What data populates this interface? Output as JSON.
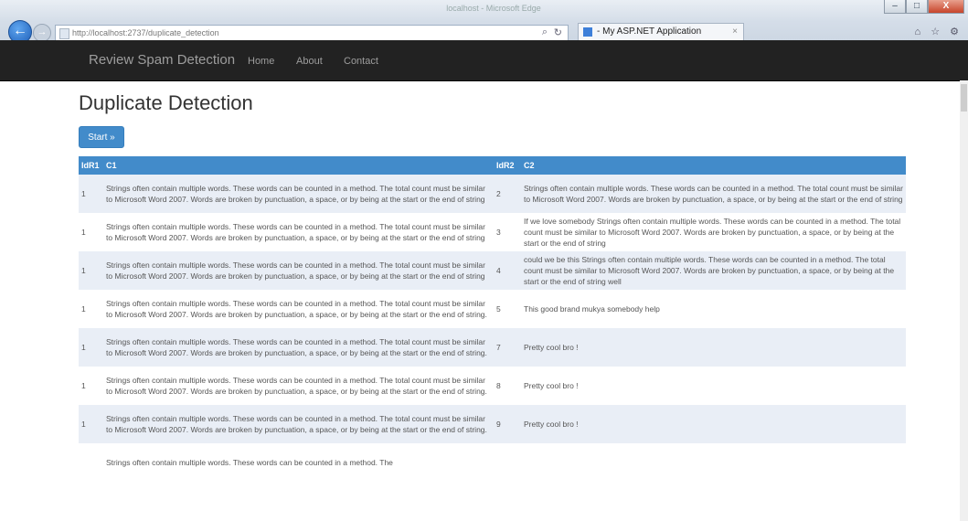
{
  "browser": {
    "window_title": "localhost - Microsoft Edge",
    "url": "http://localhost:2737/duplicate_detection",
    "tab_title": "- My ASP.NET Application",
    "tab_close": "×",
    "back": "←",
    "forward": "→",
    "win_min": "–",
    "win_max": "□",
    "win_close": "X",
    "right_icons": "⌂ ☆ ⚙"
  },
  "navbar": {
    "brand": "Review Spam Detection",
    "links": [
      "Home",
      "About",
      "Contact"
    ]
  },
  "page": {
    "title": "Duplicate Detection",
    "start_button": "Start »"
  },
  "table": {
    "headers": [
      "IdR1",
      "C1",
      "IdR2",
      "C2"
    ],
    "rows": [
      {
        "id1": "1",
        "c1": "Strings often contain multiple words. These words can be counted in a method. The total count must be similar to Microsoft Word 2007. Words are broken by punctuation, a space, or by being at the start or the end of string",
        "id2": "2",
        "c2": "Strings often contain multiple words. These words can be counted in a method. The total count must be similar to Microsoft Word 2007. Words are broken by punctuation, a space, or by being at the start or the end of string"
      },
      {
        "id1": "1",
        "c1": "Strings often contain multiple words. These words can be counted in a method. The total count must be similar to Microsoft Word 2007. Words are broken by punctuation, a space, or by being at the start or the end of string",
        "id2": "3",
        "c2": "If we love somebody Strings often contain multiple words. These words can be counted in a method. The total count must be similar to Microsoft Word 2007. Words are broken by punctuation, a space, or by being at the start or the end of string"
      },
      {
        "id1": "1",
        "c1": "Strings often contain multiple words. These words can be counted in a method. The total count must be similar to Microsoft Word 2007. Words are broken by punctuation, a space, or by being at the start or the end of string",
        "id2": "4",
        "c2": "could we be this Strings often contain multiple words. These words can be counted in a method. The total count must be similar to Microsoft Word 2007. Words are broken by punctuation, a space, or by being at the start or the end of string well"
      },
      {
        "id1": "1",
        "c1": "Strings often contain multiple words. These words can be counted in a method. The total count must be similar to Microsoft Word 2007. Words are broken by punctuation, a space, or by being at the start or the end of string.",
        "id2": "5",
        "c2": "This good brand mukya somebody help"
      },
      {
        "id1": "1",
        "c1": "Strings often contain multiple words. These words can be counted in a method. The total count must be similar to Microsoft Word 2007. Words are broken by punctuation, a space, or by being at the start or the end of string.",
        "id2": "7",
        "c2": "Pretty cool bro !"
      },
      {
        "id1": "1",
        "c1": "Strings often contain multiple words. These words can be counted in a method. The total count must be similar to Microsoft Word 2007. Words are broken by punctuation, a space, or by being at the start or the end of string.",
        "id2": "8",
        "c2": "Pretty cool bro !"
      },
      {
        "id1": "1",
        "c1": "Strings often contain multiple words. These words can be counted in a method. The total count must be similar to Microsoft Word 2007. Words are broken by punctuation, a space, or by being at the start or the end of string.",
        "id2": "9",
        "c2": "Pretty cool bro !"
      },
      {
        "id1": "",
        "c1": "Strings often contain multiple words. These words can be counted in a method. The",
        "id2": "",
        "c2": ""
      }
    ]
  },
  "colors": {
    "navbar_bg": "#222222",
    "accent": "#428bca",
    "row_alt": "#e9eef6"
  }
}
